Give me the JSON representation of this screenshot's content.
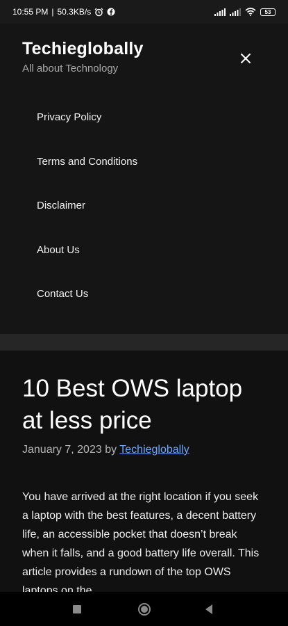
{
  "status_bar": {
    "time": "10:55 PM",
    "separator": "|",
    "speed": "50.3KB/s",
    "battery": "53",
    "icons": [
      "alarm-icon",
      "facebook-icon",
      "signal-icon",
      "signal-icon",
      "wifi-icon",
      "battery-icon"
    ]
  },
  "header": {
    "site_title": "Techieglobally",
    "tagline": "All about Technology",
    "close_icon": "close-icon"
  },
  "menu": {
    "items": [
      {
        "label": "Privacy Policy"
      },
      {
        "label": "Terms and Conditions"
      },
      {
        "label": "Disclaimer"
      },
      {
        "label": "About Us"
      },
      {
        "label": "Contact Us"
      }
    ]
  },
  "article": {
    "title": "10 Best OWS laptop at less price",
    "date": "January 7, 2023",
    "by": "by",
    "author": "Techieglobally",
    "body": "You have arrived at the right location if you seek a laptop with the best features, a decent battery life, an accessible pocket that doesn’t break when it falls, and a good battery life overall. This article provides a rundown of the top OWS laptops on the"
  },
  "nav_bar": {
    "icons": [
      "recents-square-icon",
      "home-circle-icon",
      "back-triangle-icon"
    ]
  },
  "colors": {
    "background": "#111111",
    "panel": "#151515",
    "link": "#6aa7ff",
    "tagline": "#a9a9a9"
  }
}
